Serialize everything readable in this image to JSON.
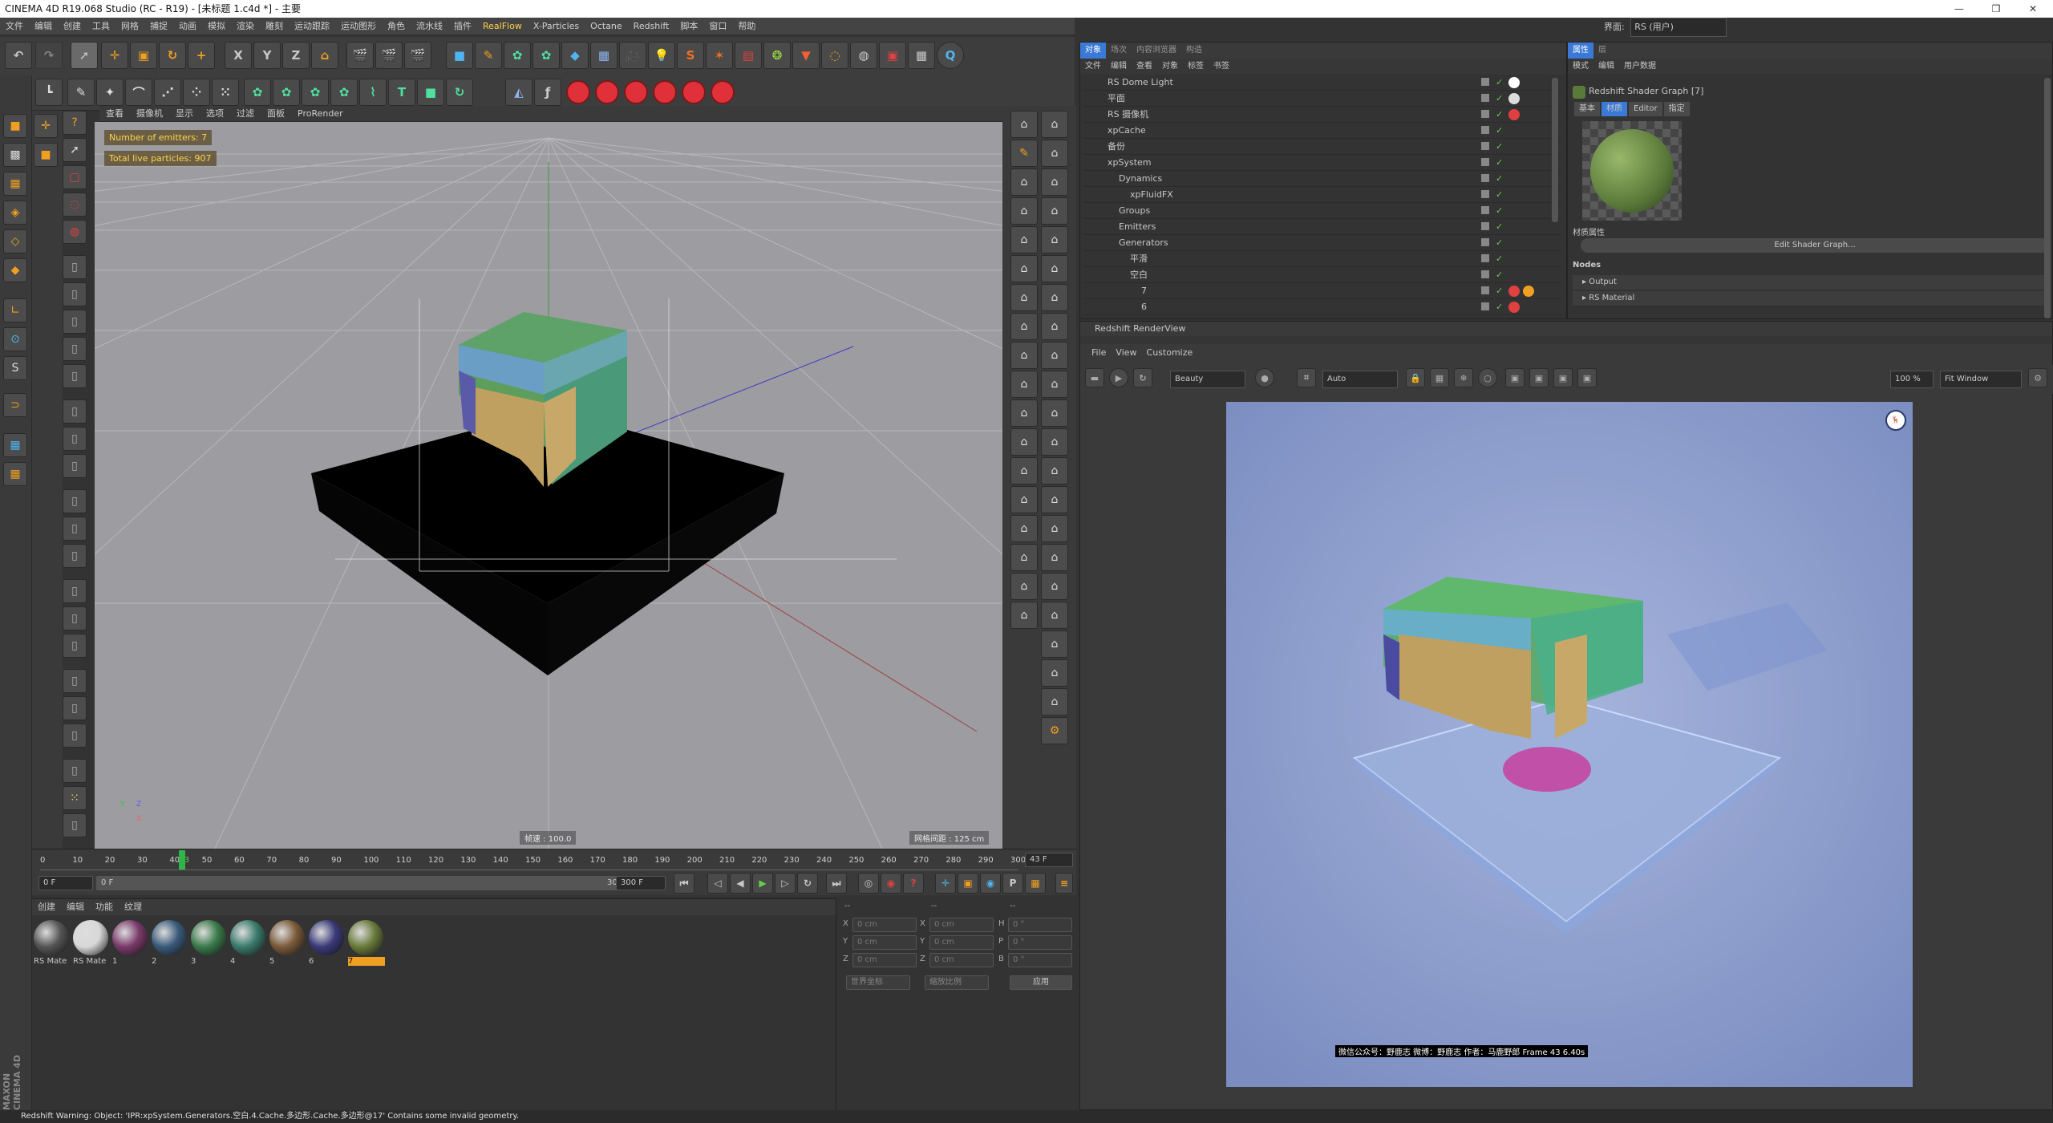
{
  "window": {
    "title": "CINEMA 4D R19.068 Studio (RC - R19) - [未标题 1.c4d *] - 主要",
    "interface_label": "界面:",
    "interface_value": "RS (用户)"
  },
  "menubar": [
    "文件",
    "编辑",
    "创建",
    "工具",
    "网格",
    "捕捉",
    "动画",
    "模拟",
    "渲染",
    "雕刻",
    "运动跟踪",
    "运动图形",
    "角色",
    "流水线",
    "插件",
    "RealFlow",
    "X-Particles",
    "Octane",
    "Redshift",
    "脚本",
    "窗口",
    "帮助"
  ],
  "menubar_highlight": "RealFlow",
  "toolbar": {
    "axis": [
      "X",
      "Y",
      "Z"
    ]
  },
  "viewport": {
    "menu": [
      "查看",
      "摄像机",
      "显示",
      "选项",
      "过滤",
      "面板",
      "ProRender"
    ],
    "hud": [
      "Number of emitters: 7",
      "Total live particles: 907"
    ],
    "speed": "帧速 : 100.0",
    "grid_spacing": "网格间距 : 125 cm",
    "axis_labels": [
      "Y",
      "Z",
      "X"
    ]
  },
  "timeline": {
    "ticks": [
      "0",
      "10",
      "20",
      "30",
      "40",
      "43",
      "50",
      "60",
      "70",
      "80",
      "90",
      "100",
      "110",
      "120",
      "130",
      "140",
      "150",
      "160",
      "170",
      "180",
      "190",
      "200",
      "210",
      "220",
      "230",
      "240",
      "250",
      "260",
      "270",
      "280",
      "290",
      "300"
    ],
    "current_frame": "43 F",
    "start": "0 F",
    "slider_start": "0 F",
    "slider_end": "300 F",
    "end": "300 F"
  },
  "material_manager": {
    "menu": [
      "创建",
      "编辑",
      "功能",
      "纹理"
    ],
    "materials": [
      {
        "label": "RS Mate",
        "color": "#555555"
      },
      {
        "label": "RS Mate",
        "color": "#d8d8d8"
      },
      {
        "label": "1",
        "color": "#7a3a6a"
      },
      {
        "label": "2",
        "color": "#3a5a7a"
      },
      {
        "label": "3",
        "color": "#3a7a4a"
      },
      {
        "label": "4",
        "color": "#3a7a6a"
      },
      {
        "label": "5",
        "color": "#7a5a3a"
      },
      {
        "label": "6",
        "color": "#3a3a7a"
      },
      {
        "label": "7",
        "color": "#6a7a3a"
      }
    ]
  },
  "coords": {
    "header": [
      "--",
      "--",
      "--"
    ],
    "rows": [
      {
        "a": "X",
        "av": "0 cm",
        "b": "X",
        "bv": "0 cm",
        "c": "H",
        "cv": "0 °"
      },
      {
        "a": "Y",
        "av": "0 cm",
        "b": "Y",
        "bv": "0 cm",
        "c": "P",
        "cv": "0 °"
      },
      {
        "a": "Z",
        "av": "0 cm",
        "b": "Z",
        "bv": "0 cm",
        "c": "B",
        "cv": "0 °"
      }
    ],
    "world": "世界坐标",
    "scale": "缩放比例",
    "apply": "应用"
  },
  "object_manager": {
    "tabs": [
      "对象",
      "场次",
      "内容浏览器",
      "构造"
    ],
    "menu": [
      "文件",
      "编辑",
      "查看",
      "对象",
      "标签",
      "书签"
    ],
    "objects": [
      {
        "name": "RS Dome Light",
        "indent": 0
      },
      {
        "name": "平面",
        "indent": 0
      },
      {
        "name": "RS 摄像机",
        "indent": 0
      },
      {
        "name": "xpCache",
        "indent": 0
      },
      {
        "name": "备份",
        "indent": 0
      },
      {
        "name": "xpSystem",
        "indent": 0
      },
      {
        "name": "Dynamics",
        "indent": 1
      },
      {
        "name": "xpFluidFX",
        "indent": 2
      },
      {
        "name": "Groups",
        "indent": 1
      },
      {
        "name": "Emitters",
        "indent": 1
      },
      {
        "name": "Generators",
        "indent": 1
      },
      {
        "name": "平滑",
        "indent": 2
      },
      {
        "name": "空白",
        "indent": 2
      },
      {
        "name": "7",
        "indent": 3
      },
      {
        "name": "6",
        "indent": 3
      }
    ]
  },
  "attribute_manager": {
    "tabs": [
      "属性",
      "层"
    ],
    "menu": [
      "模式",
      "编辑",
      "用户数据"
    ],
    "title": "Redshift Shader Graph [7]",
    "subtabs": [
      "基本",
      "材质",
      "Editor",
      "指定"
    ],
    "section": "材质属性",
    "edit_button": "Edit Shader Graph...",
    "nodes_header": "Nodes",
    "nodes": [
      "Output",
      "RS Material"
    ]
  },
  "render_view": {
    "title": "Redshift RenderView",
    "menu": [
      "File",
      "View",
      "Customize"
    ],
    "aov": "Beauty",
    "auto": "Auto",
    "zoom": "100 %",
    "fit": "Fit Window",
    "caption": "微信公众号：野鹿志  微博：野鹿志  作者：马鹿野郎  Frame  43  6.40s"
  },
  "status": "Redshift Warning: Object: 'IPR:xpSystem.Generators.空白.4.Cache.多边形.Cache.多边形@17' Contains some invalid geometry.",
  "brand": "MAXON CINEMA 4D"
}
